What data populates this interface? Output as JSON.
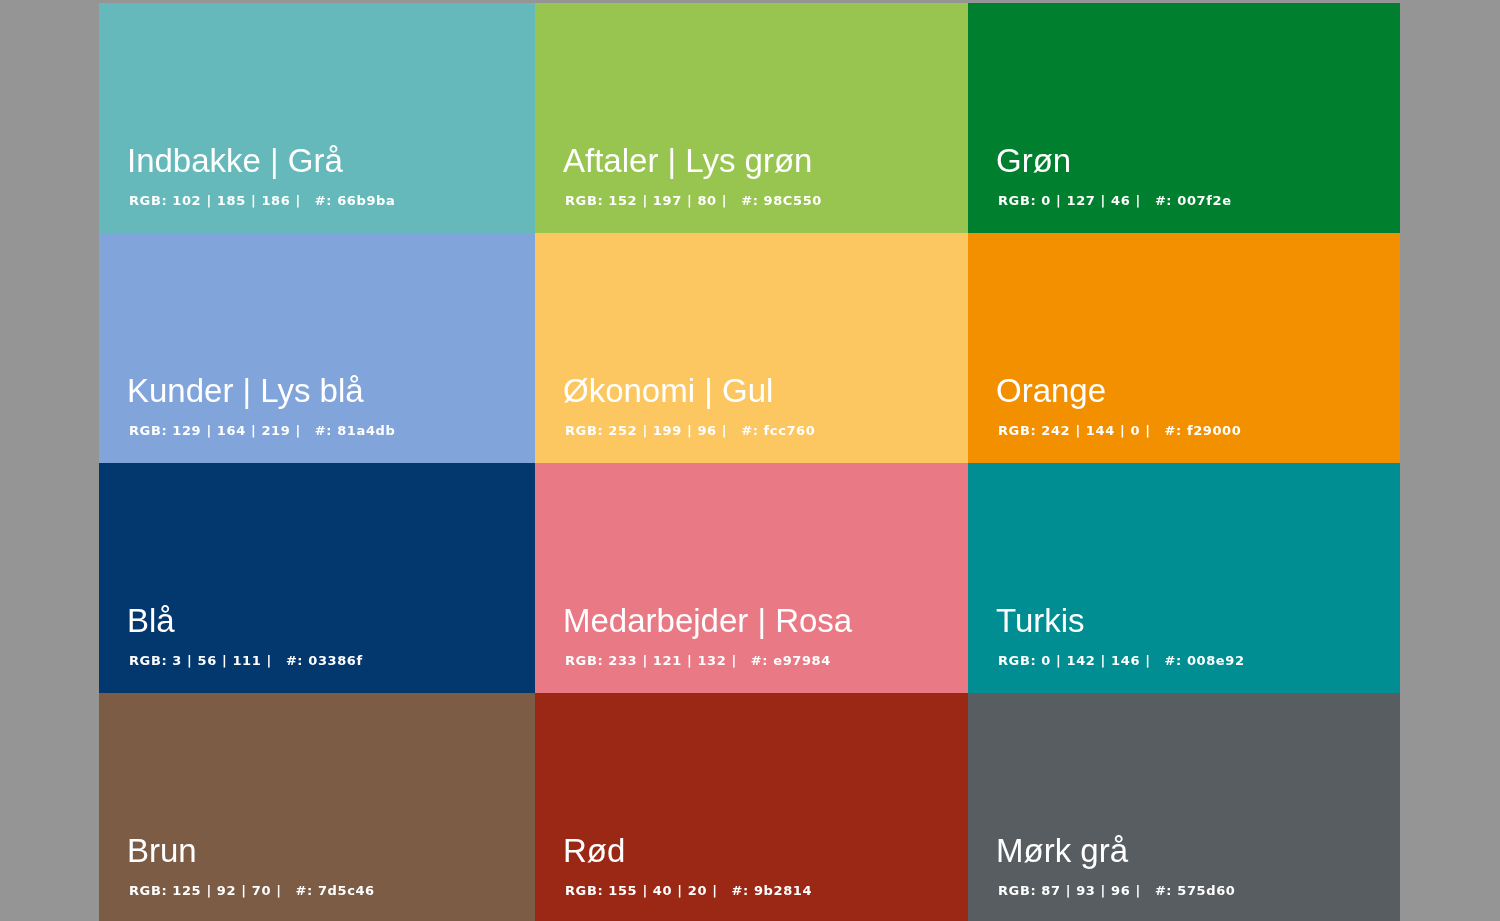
{
  "swatches": [
    {
      "title": "Indbakke | Grå",
      "rgb": "RGB: 102 | 185 | 186 |",
      "hex": "#: 66b9ba",
      "color": "#66b9ba"
    },
    {
      "title": "Aftaler | Lys grøn",
      "rgb": "RGB: 152 | 197 | 80 |",
      "hex": "#: 98C550",
      "color": "#98c550"
    },
    {
      "title": "Grøn",
      "rgb": "RGB: 0 | 127 | 46 |",
      "hex": "#: 007f2e",
      "color": "#007f2e"
    },
    {
      "title": "Kunder | Lys blå",
      "rgb": "RGB: 129 | 164 | 219 |",
      "hex": "#: 81a4db",
      "color": "#81a4db"
    },
    {
      "title": "Økonomi | Gul",
      "rgb": "RGB: 252 | 199 | 96 |",
      "hex": "#: fcc760",
      "color": "#fcc760"
    },
    {
      "title": "Orange",
      "rgb": "RGB: 242 | 144 | 0 |",
      "hex": "#: f29000",
      "color": "#f29000"
    },
    {
      "title": "Blå",
      "rgb": "RGB: 3 | 56 | 111 |",
      "hex": "#: 03386f",
      "color": "#03386f"
    },
    {
      "title": "Medarbejder | Rosa",
      "rgb": "RGB: 233 | 121 | 132 |",
      "hex": "#: e97984",
      "color": "#e97984"
    },
    {
      "title": "Turkis",
      "rgb": "RGB: 0 | 142 | 146 |",
      "hex": "#: 008e92",
      "color": "#008e92"
    },
    {
      "title": "Brun",
      "rgb": "RGB: 125 | 92 | 70 |",
      "hex": "#: 7d5c46",
      "color": "#7d5c46"
    },
    {
      "title": "Rød",
      "rgb": "RGB: 155 | 40 | 20 |",
      "hex": "#: 9b2814",
      "color": "#9b2814"
    },
    {
      "title": "Mørk grå",
      "rgb": "RGB: 87 | 93 | 96 |",
      "hex": "#: 575d60",
      "color": "#575d60"
    }
  ]
}
